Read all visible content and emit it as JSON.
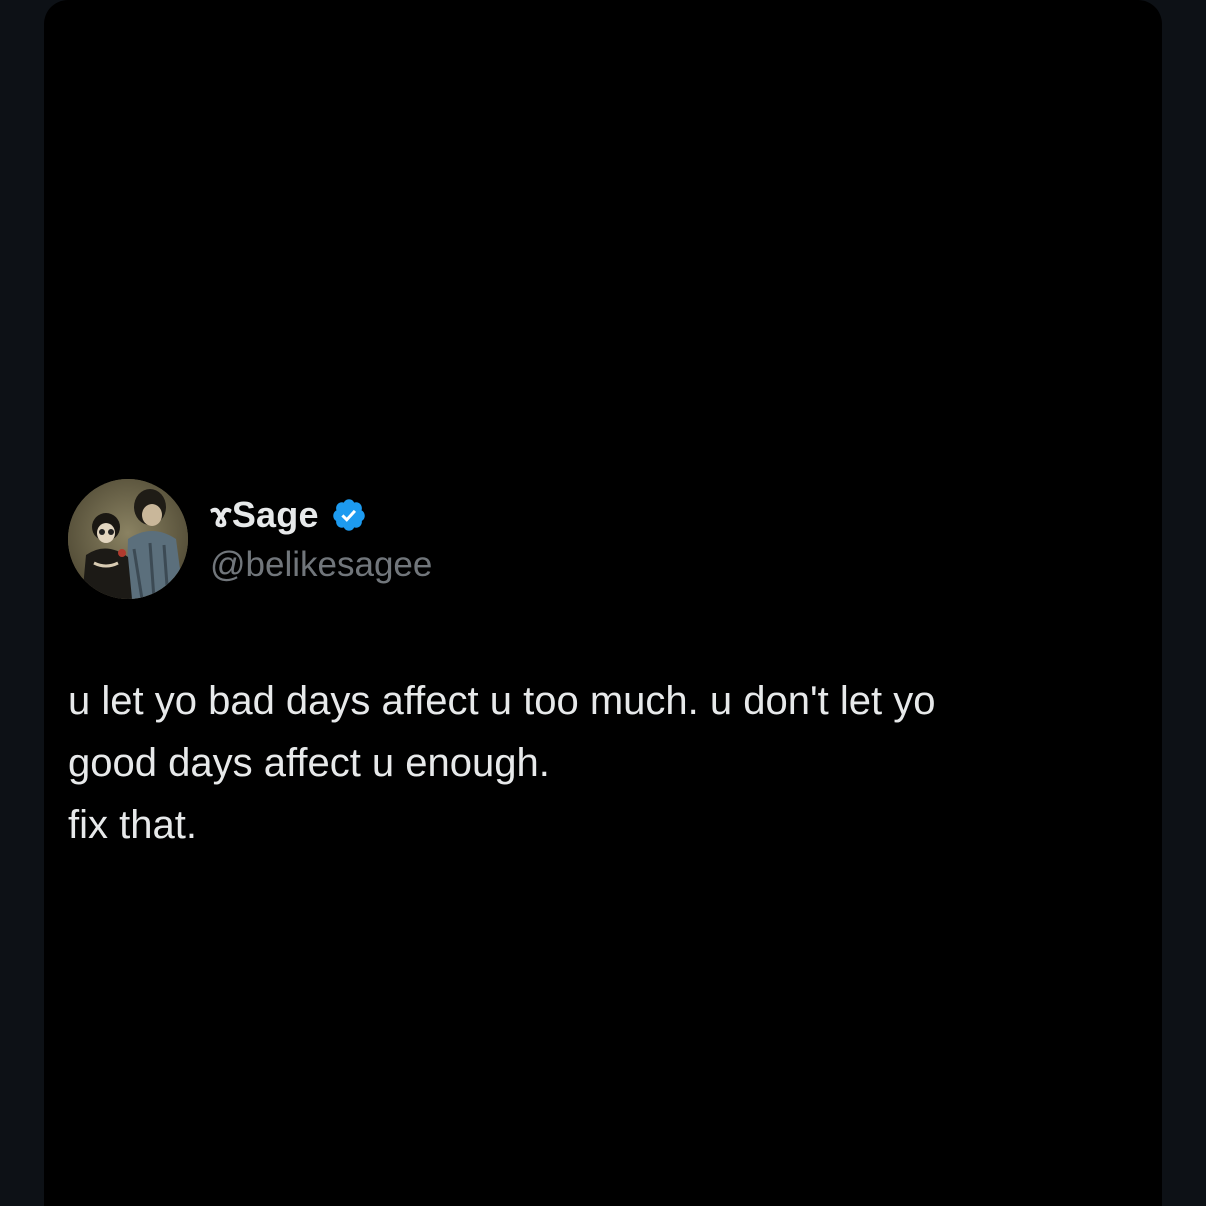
{
  "colors": {
    "page_background": "#0d1116",
    "card_background": "#000000",
    "primary_text": "#e7e9ea",
    "secondary_text": "#71767b",
    "verified_blue": "#1d9bf0"
  },
  "tweet": {
    "author": {
      "display_name": "ɤSage",
      "handle": "@belikesagee",
      "verified": true,
      "verified_icon": "verified-badge-icon",
      "avatar_icon": "profile-photo"
    },
    "text": "u let yo bad days affect u too much. u don't let yo\ngood days affect u enough.\nfix that."
  }
}
